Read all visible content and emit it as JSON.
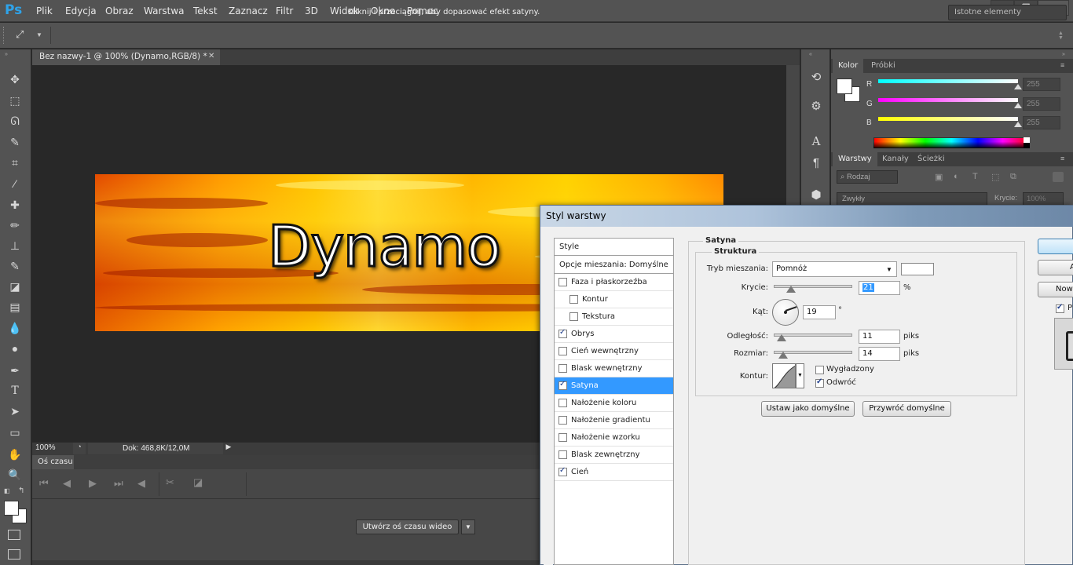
{
  "app": {
    "logo": "Ps"
  },
  "menu": [
    "Plik",
    "Edycja",
    "Obraz",
    "Warstwa",
    "Tekst",
    "Zaznacz",
    "Filtr",
    "3D",
    "Widok",
    "Okno",
    "Pomoc"
  ],
  "window_controls": {
    "minimize": "▬",
    "restore": "❐",
    "close": "✕"
  },
  "options_bar": {
    "hint": "Kliknij i przeciągnij, aby dopasować efekt satyny.",
    "workspace": "Istotne elementy"
  },
  "document": {
    "tab_title": "Bez nazwy-1 @ 100% (Dynamo,RGB/8) *",
    "image_text": "Dynamo",
    "zoom": "100%",
    "doc_info": "Dok: 468,8K/12,0M"
  },
  "timeline": {
    "tab": "Oś czasu",
    "create_button": "Utwórz oś czasu wideo"
  },
  "color_panel": {
    "tabs": [
      "Kolor",
      "Próbki"
    ],
    "channels": [
      {
        "label": "R",
        "value": "255",
        "color": "#00ffff"
      },
      {
        "label": "G",
        "value": "255",
        "color": "#ff00ff"
      },
      {
        "label": "B",
        "value": "255",
        "color": "#ffff00"
      }
    ]
  },
  "layers_panel": {
    "tabs": [
      "Warstwy",
      "Kanały",
      "Ścieżki"
    ],
    "filter": "Rodzaj",
    "blend_mode": "Zwykły",
    "opacity_label": "Krycie:",
    "opacity_value": "100%"
  },
  "dialog": {
    "title": "Styl warstwy",
    "styles_header": "Style",
    "blending_options": "Opcje mieszania: Domyślne",
    "styles": [
      {
        "label": "Faza i płaskorzeźba",
        "checked": false,
        "indent": false
      },
      {
        "label": "Kontur",
        "checked": false,
        "indent": true
      },
      {
        "label": "Tekstura",
        "checked": false,
        "indent": true
      },
      {
        "label": "Obrys",
        "checked": true,
        "indent": false
      },
      {
        "label": "Cień wewnętrzny",
        "checked": false,
        "indent": false
      },
      {
        "label": "Blask wewnętrzny",
        "checked": false,
        "indent": false
      },
      {
        "label": "Satyna",
        "checked": true,
        "indent": false,
        "selected": true
      },
      {
        "label": "Nałożenie koloru",
        "checked": false,
        "indent": false
      },
      {
        "label": "Nałożenie gradientu",
        "checked": false,
        "indent": false
      },
      {
        "label": "Nałożenie wzorku",
        "checked": false,
        "indent": false
      },
      {
        "label": "Blask zewnętrzny",
        "checked": false,
        "indent": false
      },
      {
        "label": "Cień",
        "checked": true,
        "indent": false
      }
    ],
    "section_title": "Satyna",
    "subsection_title": "Struktura",
    "blend_mode_label": "Tryb mieszania:",
    "blend_mode_value": "Pomnóż",
    "opacity_label": "Krycie:",
    "opacity_value": "21",
    "opacity_unit": "%",
    "angle_label": "Kąt:",
    "angle_value": "19",
    "angle_unit": "°",
    "distance_label": "Odległość:",
    "distance_value": "11",
    "distance_unit": "piks",
    "size_label": "Rozmiar:",
    "size_value": "14",
    "size_unit": "piks",
    "contour_label": "Kontur:",
    "antialiased_label": "Wygładzony",
    "antialiased_checked": false,
    "invert_label": "Odwróć",
    "invert_checked": true,
    "set_default_btn": "Ustaw jako domyślne",
    "reset_default_btn": "Przywróć domyślne",
    "right_buttons": [
      "",
      "A",
      "Now"
    ],
    "preview_label": "P",
    "preview_checked": true
  }
}
